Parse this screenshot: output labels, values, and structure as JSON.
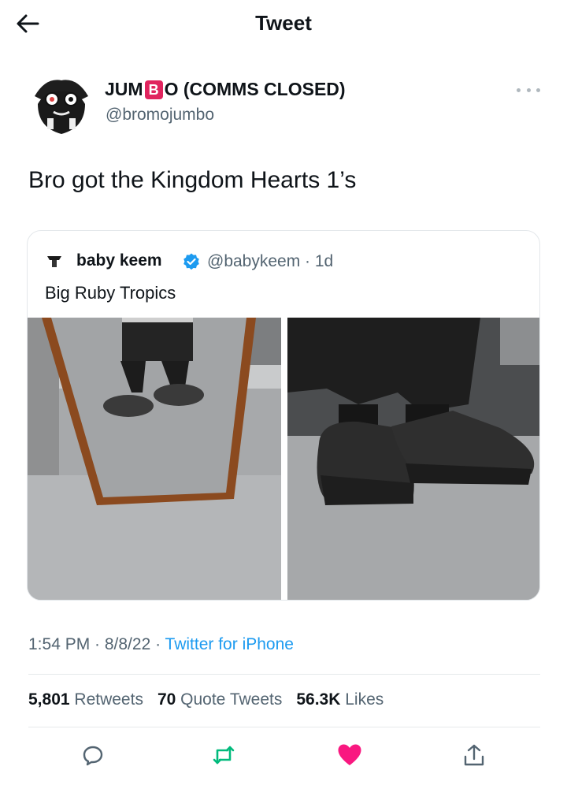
{
  "header": {
    "title": "Tweet",
    "back_icon": "arrow-left-icon"
  },
  "author": {
    "name_part1": "JUM",
    "name_block_letter": "B",
    "name_part2": "O (COMMS CLOSED)",
    "handle": "@bromojumbo"
  },
  "tweet": {
    "text": "Bro got the Kingdom Hearts 1’s"
  },
  "quote": {
    "name": "baby keem",
    "handle_time": "@babykeem · 1d",
    "text": "Big Ruby Tropics",
    "verified_color": "#1d9bf0"
  },
  "meta": {
    "time_date": "1:54 PM · 8/8/22 · ",
    "source": "Twitter for iPhone"
  },
  "stats": {
    "retweets_count": "5,801",
    "retweets_label": "Retweets",
    "quotes_count": "70",
    "quotes_label": "Quote Tweets",
    "likes_count": "56.3K",
    "likes_label": "Likes"
  },
  "actions": {
    "reply_icon": "reply-icon",
    "retweet_icon": "retweet-icon",
    "like_icon": "heart-icon",
    "share_icon": "share-icon",
    "retweet_color": "#00ba7c",
    "like_color": "#f91880"
  }
}
